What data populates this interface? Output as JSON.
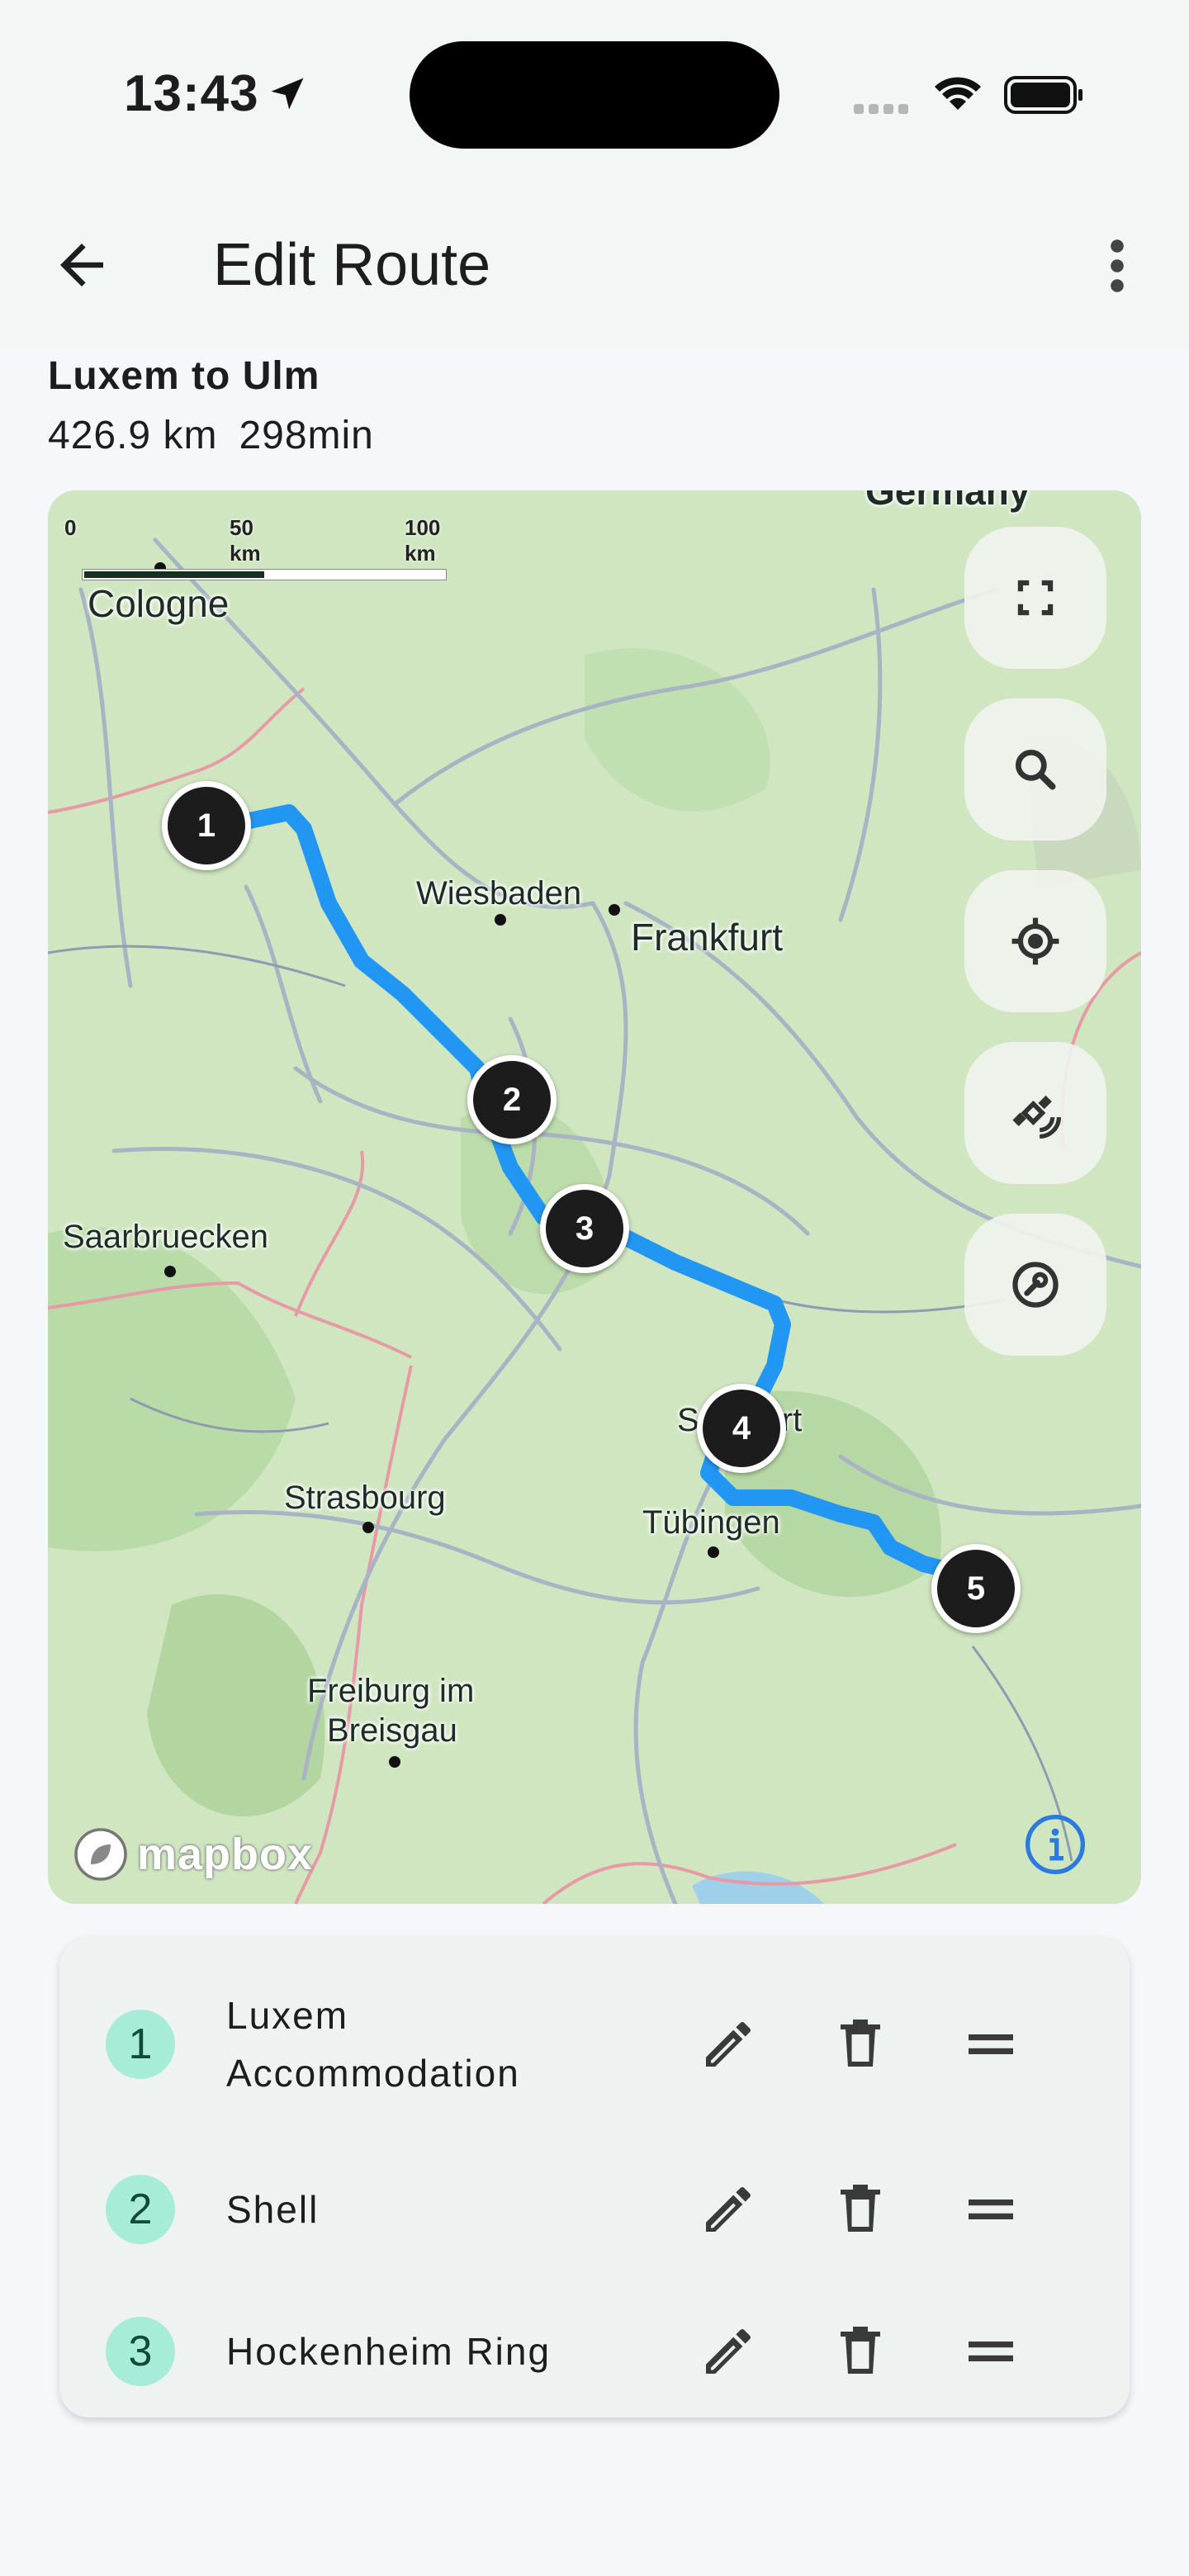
{
  "status_bar": {
    "time": "13:43",
    "icons": [
      "location-arrow-icon",
      "signal-icon",
      "wifi-icon",
      "battery-icon"
    ]
  },
  "app_bar": {
    "title": "Edit Route",
    "back_icon": "arrow-back-icon",
    "menu_icon": "more-vert-icon"
  },
  "route": {
    "name": "Luxem to Ulm",
    "distance": "426.9 km",
    "duration": "298min"
  },
  "map": {
    "route_color": "#2196f3",
    "scale_labels": [
      "0",
      "50 km",
      "100 km"
    ],
    "country_label": "Germany",
    "places": [
      "Cologne",
      "Wiesbaden",
      "Frankfurt",
      "Saarbruecken",
      "Stuttgart",
      "Strasbourg",
      "Tübingen",
      "Freiburg im",
      "Breisgau"
    ],
    "markers": [
      "1",
      "2",
      "3",
      "4",
      "5"
    ],
    "attribution": "mapbox",
    "controls": [
      "fullscreen-icon",
      "search-icon",
      "my-location-icon",
      "satellite-icon",
      "settings-wrench-icon"
    ]
  },
  "waypoints": [
    {
      "index": "1",
      "name_line1": "Luxem",
      "name_line2": "Accommodation"
    },
    {
      "index": "2",
      "name_line1": "Shell",
      "name_line2": ""
    },
    {
      "index": "3",
      "name_line1": "Hockenheim Ring",
      "name_line2": ""
    }
  ],
  "waypoint_actions": [
    "edit-icon",
    "delete-icon",
    "drag-handle-icon"
  ],
  "colors": {
    "background": "#f5f7fa",
    "app_bar": "#f2f6f5",
    "badge": "#a6ecd8",
    "marker": "#1c1c1c"
  }
}
